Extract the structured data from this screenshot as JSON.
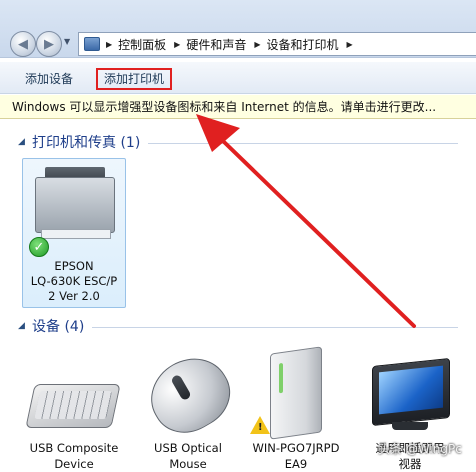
{
  "address_bar": {
    "breadcrumbs": [
      "控制面板",
      "硬件和声音",
      "设备和打印机"
    ]
  },
  "toolbar": {
    "add_device_label": "添加设备",
    "add_printer_label": "添加打印机"
  },
  "infobar": {
    "message": "Windows 可以显示增强型设备图标和来自 Internet 的信息。请单击进行更改..."
  },
  "groups": {
    "printers": {
      "title": "打印机和传真 (1)"
    },
    "devices": {
      "title": "设备 (4)"
    }
  },
  "printers": [
    {
      "name_lines": [
        "EPSON",
        "LQ-630K ESC/P",
        "2 Ver 2.0"
      ],
      "status": "default"
    }
  ],
  "devices": [
    {
      "name_lines": [
        "USB Composite",
        "Device"
      ],
      "icon": "keyboard-icon"
    },
    {
      "name_lines": [
        "USB Optical",
        "Mouse"
      ],
      "icon": "mouse-icon"
    },
    {
      "name_lines": [
        "WIN-PGO7JRPD",
        "EA9"
      ],
      "icon": "computer-tower-icon",
      "warning": true
    },
    {
      "name_lines": [
        "通用即插即用",
        "视器"
      ],
      "icon": "monitor-icon"
    }
  ],
  "watermark": "头条 @WingPc",
  "colors": {
    "annotation_red": "#e02020",
    "group_title_blue": "#1e3e8a",
    "infobar_bg": "#ffffe1"
  }
}
